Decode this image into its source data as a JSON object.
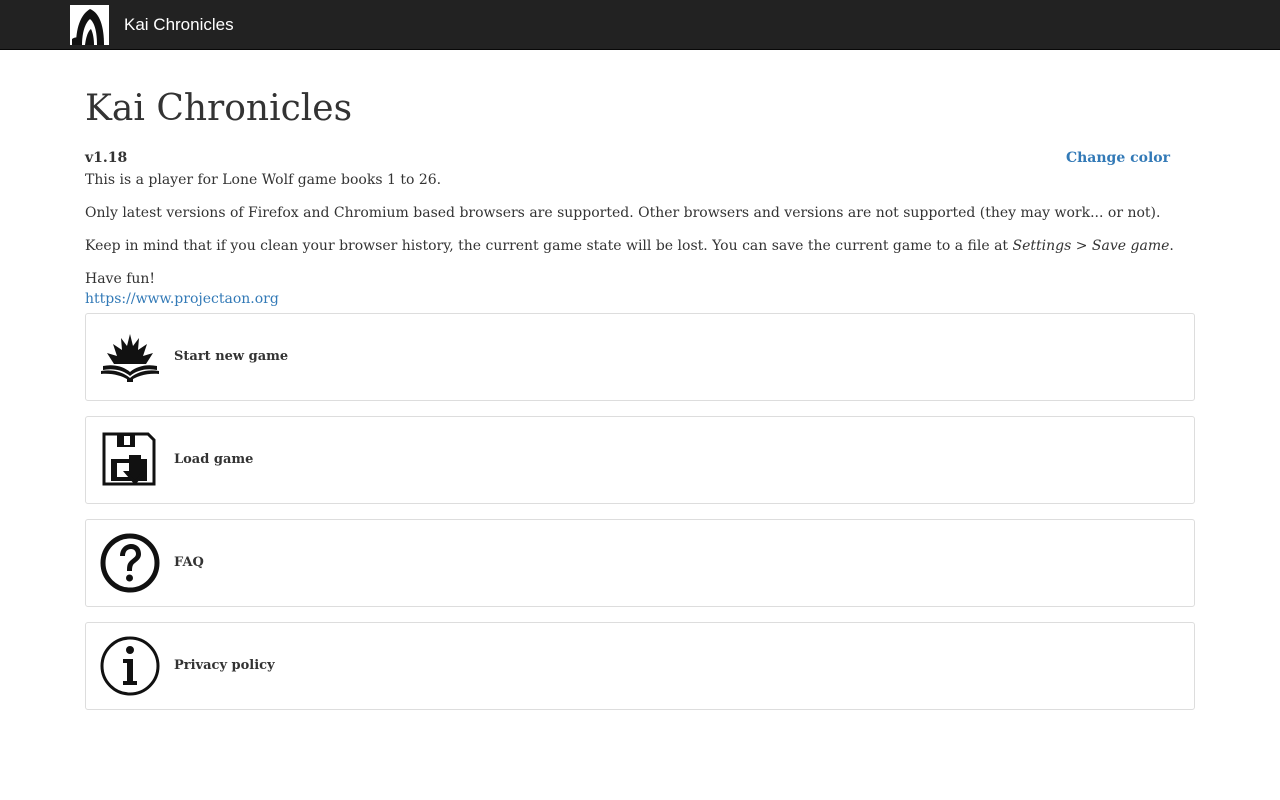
{
  "navbar": {
    "logo_icon": "hooded-figure-icon",
    "brand": "Kai Chronicles"
  },
  "main": {
    "title": "Kai Chronicles",
    "version": "v1.18",
    "change_color": "Change color",
    "intro": "This is a player for Lone Wolf game books 1 to 26.",
    "browsers": "Only latest versions of Firefox and Chromium based browsers are supported. Other browsers and versions are not supported (they may work... or not).",
    "history_prefix": "Keep in mind that if you clean your browser history, the current game state will be lost. You can save the current game to a file at ",
    "history_settings": "Settings",
    "history_sep": " > ",
    "history_save": "Save game",
    "history_suffix": ".",
    "have_fun": "Have fun!",
    "link": "https://www.projectaon.org"
  },
  "menu": [
    {
      "label": "Start new game",
      "icon": "flaming-book-icon"
    },
    {
      "label": "Load game",
      "icon": "floppy-load-icon"
    },
    {
      "label": "FAQ",
      "icon": "question-mark-icon"
    },
    {
      "label": "Privacy policy",
      "icon": "info-icon"
    }
  ],
  "colors": {
    "navbar_bg": "#222222",
    "link": "#337ab7",
    "text": "#333333",
    "border": "#dddddd"
  }
}
